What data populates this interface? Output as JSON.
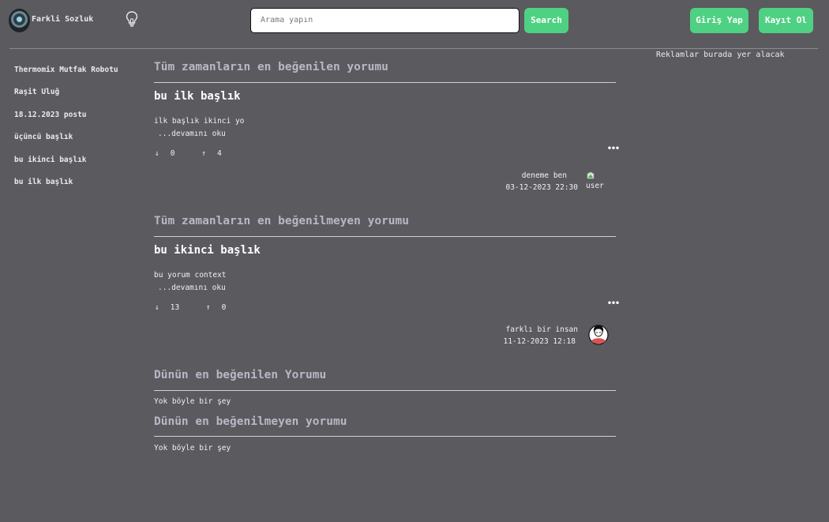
{
  "header": {
    "site_title": "Farkli Sozluk",
    "search_placeholder": "Arama yapın",
    "search_button": "Search",
    "login_button": "Giriş Yap",
    "signup_button": "Kayıt Ol"
  },
  "ads": {
    "text": "Reklamlar burada yer alacak"
  },
  "sidebar": {
    "items": [
      {
        "label": "Thermomix Mutfak Robotu"
      },
      {
        "label": "Raşit Uluğ"
      },
      {
        "label": "18.12.2023 postu"
      },
      {
        "label": "üçüncü başlık"
      },
      {
        "label": "bu ikinci başlık"
      },
      {
        "label": "bu ilk başlık"
      }
    ]
  },
  "sections": {
    "best_all_time": {
      "title": "Tüm zamanların en beğenilen yorumu",
      "post_title": "bu ilk başlık",
      "body": "ilk başlık ikinci yo",
      "read_more": "...devamını oku",
      "downvotes": "0",
      "upvotes": "4",
      "author": "deneme ben",
      "date": "03-12-2023 22:30",
      "avatar_alt": "user"
    },
    "worst_all_time": {
      "title": "Tüm zamanların en beğenilmeyen yorumu",
      "post_title": "bu ikinci başlık",
      "body": "bu yorum context",
      "read_more": "...devamını oku",
      "downvotes": "13",
      "upvotes": "0",
      "author": "farklı bir insan",
      "date": "11-12-2023 12:18"
    },
    "best_yesterday": {
      "title": "Dünün en beğenilen Yorumu",
      "empty": "Yok böyle bir şey"
    },
    "worst_yesterday": {
      "title": "Dünün en beğenilmeyen yorumu",
      "empty": "Yok böyle bir şey"
    }
  },
  "icons": {
    "down_arrow": "↓",
    "up_arrow": "↑",
    "menu": "•••"
  },
  "colors": {
    "background": "#5b5a5f",
    "accent": "#4fd183",
    "section_title": "#b7b8c6"
  }
}
